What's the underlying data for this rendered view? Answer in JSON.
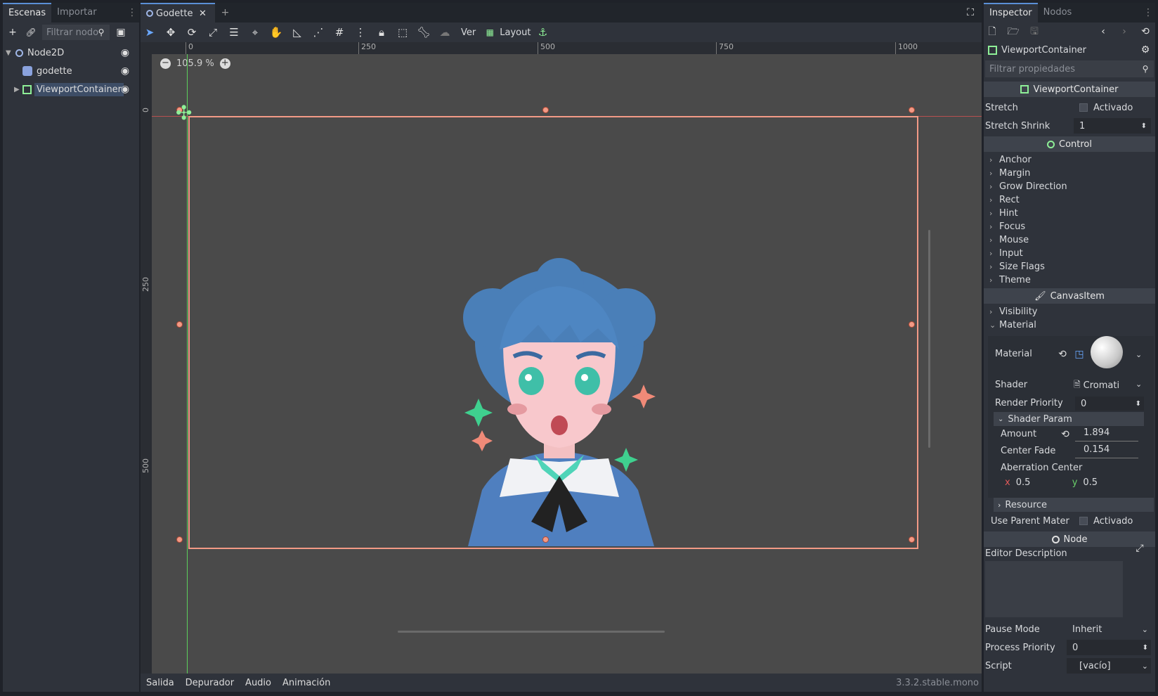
{
  "left_dock": {
    "tabs": [
      "Escenas",
      "Importar"
    ],
    "filter_placeholder": "Filtrar nodo",
    "tree": [
      {
        "label": "Node2D"
      },
      {
        "label": "godette"
      },
      {
        "label": "ViewportContainer"
      }
    ]
  },
  "editor": {
    "scene_tab": "Godette",
    "menu_ver": "Ver",
    "menu_layout": "Layout",
    "zoom": "105.9 %",
    "ruler_h": [
      "0",
      "250",
      "500",
      "750",
      "1000"
    ],
    "ruler_v": [
      "0",
      "250",
      "500"
    ],
    "bottom_tabs": [
      "Salida",
      "Depurador",
      "Audio",
      "Animación"
    ],
    "version": "3.3.2.stable.mono"
  },
  "inspector": {
    "tabs": [
      "Inspector",
      "Nodos"
    ],
    "node_name": "ViewportContainer",
    "filter_placeholder": "Filtrar propiedades",
    "class_header": "ViewportContainer",
    "stretch_label": "Stretch",
    "stretch_value": "Activado",
    "stretch_shrink_label": "Stretch Shrink",
    "stretch_shrink_value": "1",
    "control_header": "Control",
    "control_groups": [
      "Anchor",
      "Margin",
      "Grow Direction",
      "Rect",
      "Hint",
      "Focus",
      "Mouse",
      "Input",
      "Size Flags",
      "Theme"
    ],
    "canvasitem_header": "CanvasItem",
    "canvas_groups": [
      "Visibility",
      "Material"
    ],
    "material_label": "Material",
    "shader_label": "Shader",
    "shader_value": "Cromati",
    "render_priority_label": "Render Priority",
    "render_priority_value": "0",
    "shader_param_label": "Shader Param",
    "amount_label": "Amount",
    "amount_value": "1.894",
    "center_fade_label": "Center Fade",
    "center_fade_value": "0.154",
    "aberration_center_label": "Aberration Center",
    "aberration_x_label": "x",
    "aberration_x": "0.5",
    "aberration_y_label": "y",
    "aberration_y": "0.5",
    "resource_label": "Resource",
    "use_parent_label": "Use Parent Mater",
    "use_parent_value": "Activado",
    "node_header": "Node",
    "editor_description_label": "Editor Description",
    "pause_mode_label": "Pause Mode",
    "pause_mode_value": "Inherit",
    "process_priority_label": "Process Priority",
    "process_priority_value": "0",
    "script_label": "Script",
    "script_value": "[vacío]"
  },
  "colors": {
    "selection": "#f29a86",
    "accent": "#5b8fd6",
    "green_node": "#8eef97"
  }
}
